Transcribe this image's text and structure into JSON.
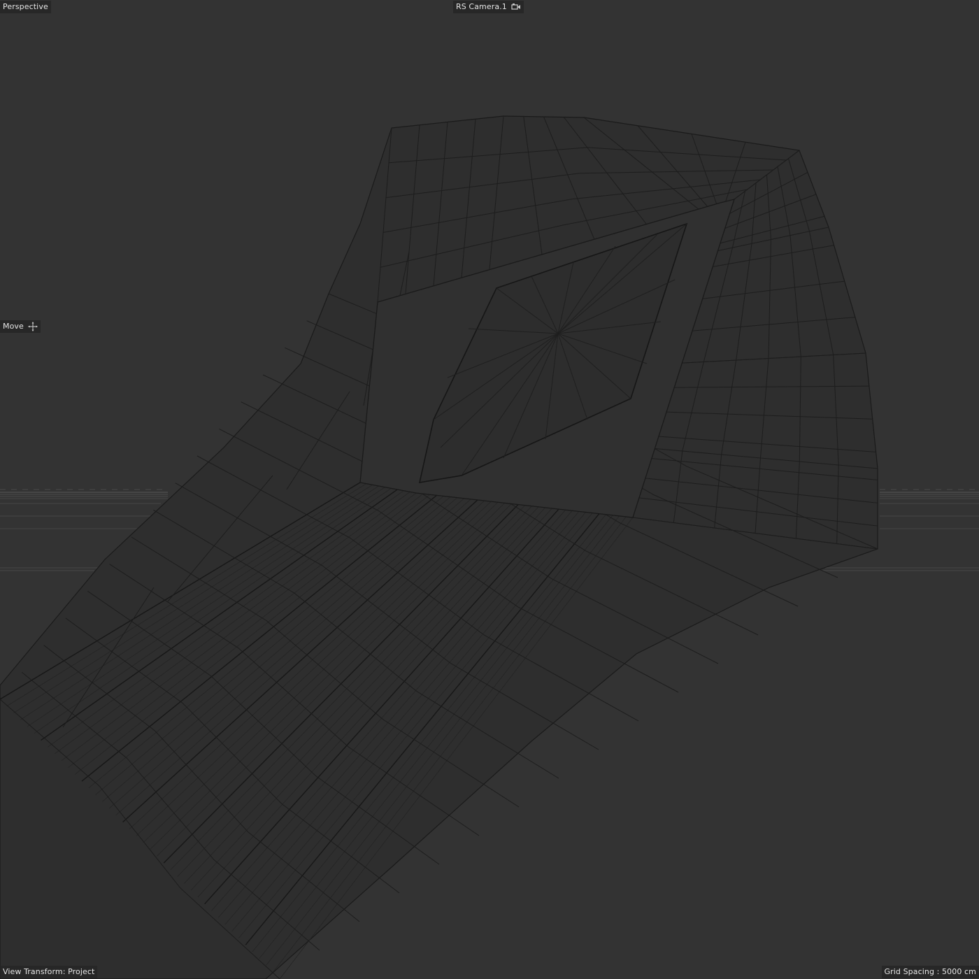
{
  "viewport": {
    "view_name": "Perspective",
    "camera_name": "RS Camera.1",
    "camera_icon": "camera-link-icon",
    "active_tool": "Move",
    "tool_icon": "move-icon",
    "view_transform": "View Transform: Project",
    "grid_spacing": "Grid Spacing : 5000 cm"
  },
  "colors": {
    "background": "#333333",
    "wire": "#1c1c1c",
    "wire_light": "#262626",
    "surface": "#2f2f2f",
    "horizon": "#555555",
    "hud_text": "#e6e6e6"
  },
  "scene": {
    "display_mode": "wireframe",
    "object": "lofted sweep mesh with inset quad panel"
  }
}
